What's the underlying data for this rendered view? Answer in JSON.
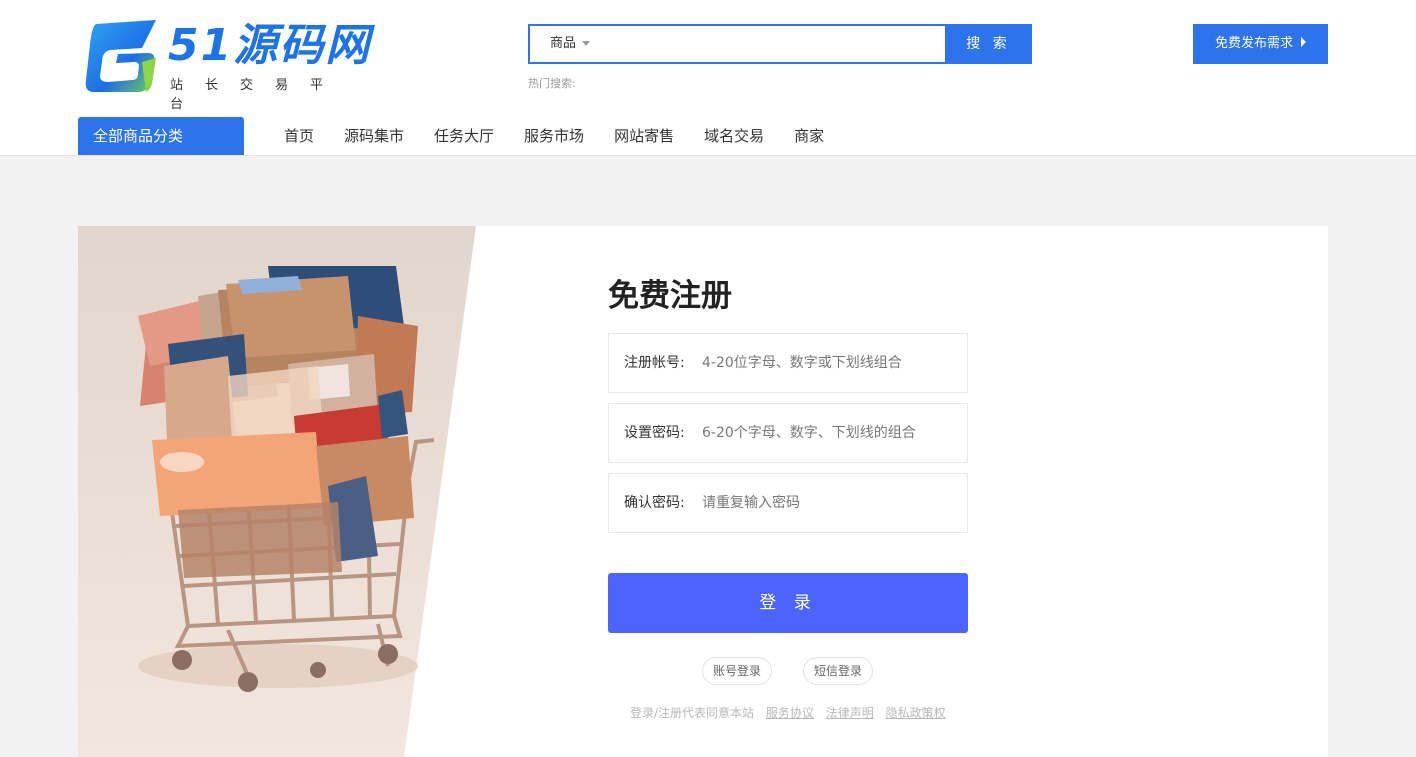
{
  "colors": {
    "accent": "#2d73e9",
    "login_button": "#4a64fd"
  },
  "header": {
    "logo_name": "51源码网",
    "logo_slogan": "站长交易平台",
    "search": {
      "type_label": "商品",
      "placeholder": "",
      "button_label": "搜 索"
    },
    "hot_search_label": "热门搜索:",
    "publish_label": "免费发布需求"
  },
  "nav": {
    "category_label": "全部商品分类",
    "items": [
      "首页",
      "源码集市",
      "任务大厅",
      "服务市场",
      "网站寄售",
      "域名交易",
      "商家"
    ]
  },
  "form": {
    "title": "免费注册",
    "fields": [
      {
        "label": "注册帐号:",
        "placeholder": "4-20位字母、数字或下划线组合"
      },
      {
        "label": "设置密码:",
        "placeholder": "6-20个字母、数字、下划线的组合"
      },
      {
        "label": "确认密码:",
        "placeholder": "请重复输入密码"
      }
    ],
    "submit_label": "登 录",
    "alt_logins": [
      "账号登录",
      "短信登录"
    ],
    "agreement_text": "登录/注册代表同意本站",
    "agreement_links": [
      "服务协议",
      "法律声明",
      "隐私政策权"
    ]
  },
  "icons": [
    "logo-icon",
    "chevron-down-icon",
    "caret-right-icon",
    "shopping-cart-illustration"
  ]
}
